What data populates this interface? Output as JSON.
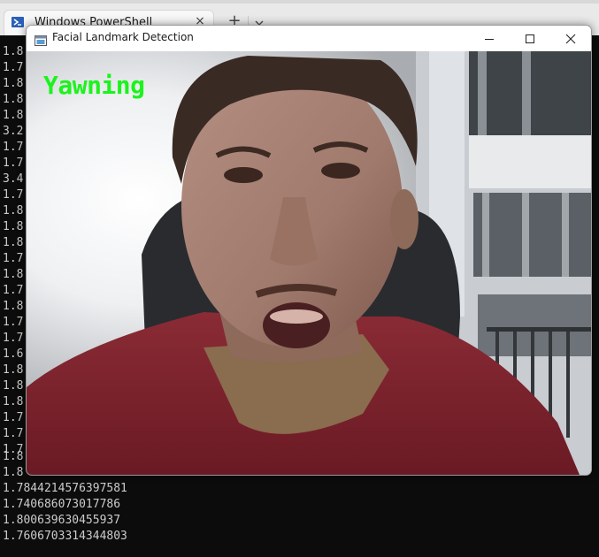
{
  "powershell": {
    "tab_title": "Windows PowerShell",
    "tab_close_glyph": "×",
    "new_tab_glyph": "+",
    "icon": "powershell-icon",
    "console_lines": [
      "1.8",
      "1.7",
      "1.8",
      "1.8",
      "1.8",
      "3.2",
      "1.7",
      "1.7",
      "3.4",
      "1.7",
      "1.8",
      "1.8",
      "1.8",
      "1.7",
      "1.8",
      "1.7",
      "1.8",
      "1.7",
      "1.7",
      "1.6",
      "1.8",
      "1.8",
      "1.8",
      "1.7",
      "1.7",
      "1.7",
      "1.8",
      "1.8",
      "1.7844214576397581",
      "1.740686073017786",
      "1.800639630455937",
      "1.7606703314344803"
    ],
    "text_color": "#cccccc",
    "background": "#0c0c0c"
  },
  "facial_window": {
    "title": "Facial Landmark Detection",
    "status_text": "Yawning",
    "status_color": "#1cf31c",
    "controls": [
      "minimize-icon",
      "maximize-icon",
      "close-icon"
    ]
  }
}
